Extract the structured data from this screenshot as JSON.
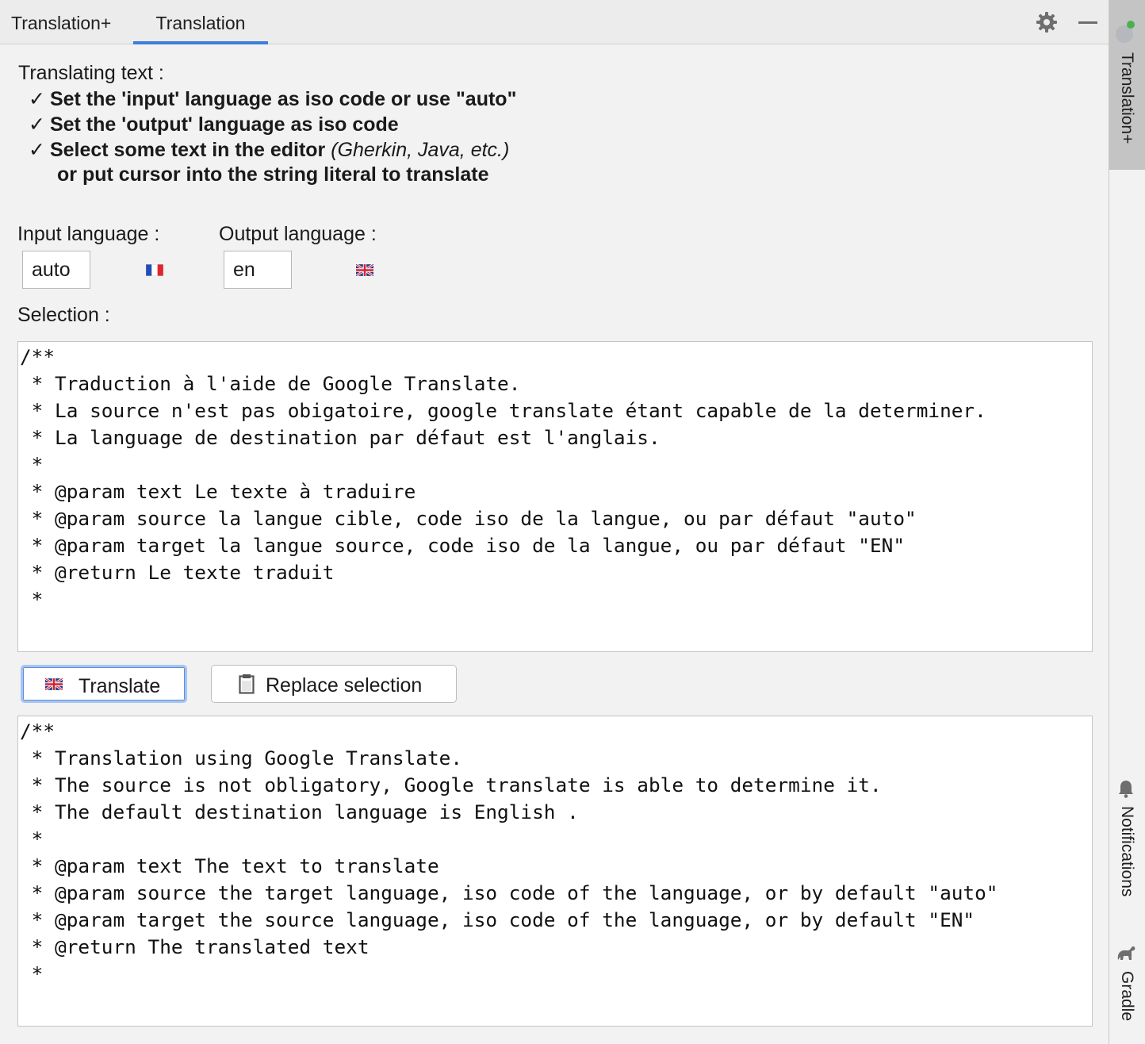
{
  "tabs": [
    {
      "label": "Translation+"
    },
    {
      "label": "Translation",
      "active": true
    }
  ],
  "toolbar": {
    "settings_icon": "gear-icon",
    "minimize_icon": "minimize-icon"
  },
  "right_strip": {
    "translation_label": "Translation+",
    "notifications_label": "Notifications",
    "gradle_label": "Gradle"
  },
  "intro": {
    "title": "Translating text :",
    "check_mark": "✓",
    "line1": "Set the 'input' language as iso code or use \"auto\"",
    "line2": "Set the 'output' language as iso code",
    "line3_bold": "Select some text in the editor",
    "line3_italic_open": " (",
    "line3_italic": "Gherkin, Java, etc.",
    "line3_italic_close": ")",
    "line4": "or put cursor into the string literal to translate"
  },
  "input_language": {
    "label": "Input language :",
    "value": "auto",
    "flag": "fr"
  },
  "output_language": {
    "label": "Output language :",
    "value": "en",
    "flag": "gb"
  },
  "selection": {
    "label": "Selection :",
    "text": "/**\n * Traduction à l'aide de Google Translate.\n * La source n'est pas obigatoire, google translate étant capable de la determiner.\n * La language de destination par défaut est l'anglais.\n *\n * @param text Le texte à traduire\n * @param source la langue cible, code iso de la langue, ou par défaut \"auto\"\n * @param target la langue source, code iso de la langue, ou par défaut \"EN\"\n * @return Le texte traduit\n *"
  },
  "buttons": {
    "translate_label": "Translate",
    "replace_label": "Replace selection"
  },
  "output": {
    "text": "/**\n * Translation using Google Translate.\n * The source is not obligatory, Google translate is able to determine it.\n * The default destination language is English .\n *\n * @param text The text to translate\n * @param source the target language, iso code of the language, or by default \"auto\"\n * @param target the source language, iso code of the language, or by default \"EN\"\n * @return The translated text\n *"
  },
  "colors": {
    "accent": "#3d7edd",
    "background": "#f2f2f2",
    "active_strip": "#c4c4c4"
  }
}
